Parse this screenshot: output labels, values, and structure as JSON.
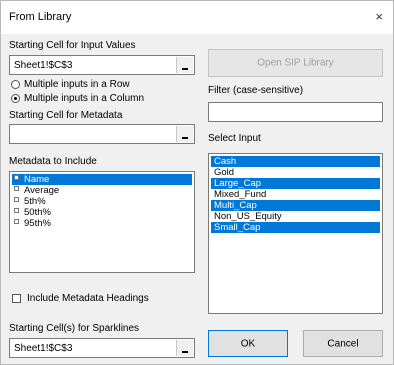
{
  "window": {
    "title": "From Library",
    "close_glyph": "×"
  },
  "input_values": {
    "label": "Starting Cell for Input Values",
    "value": "Sheet1!$C$3"
  },
  "open_sip_button": {
    "label": "Open SIP Library",
    "enabled": false
  },
  "layout_options": [
    {
      "label": "Multiple inputs in a Row",
      "checked": false
    },
    {
      "label": "Multiple inputs in a Column",
      "checked": true
    }
  ],
  "filter": {
    "label": "Filter (case-sensitive)",
    "value": ""
  },
  "metadata": {
    "label": "Starting Cell for Metadata",
    "value": ""
  },
  "select_input": {
    "label": "Select Input",
    "items": [
      {
        "text": "Cash",
        "selected": true
      },
      {
        "text": "Gold",
        "selected": false
      },
      {
        "text": "Large_Cap",
        "selected": true
      },
      {
        "text": "Mixed_Fund",
        "selected": false
      },
      {
        "text": "Multi_Cap",
        "selected": true
      },
      {
        "text": "Non_US_Equity",
        "selected": false
      },
      {
        "text": "Small_Cap",
        "selected": true
      }
    ]
  },
  "metadata_include": {
    "label": "Metadata to Include",
    "items": [
      {
        "text": "Name",
        "selected": true
      },
      {
        "text": "Average",
        "selected": false
      },
      {
        "text": "5th%",
        "selected": false
      },
      {
        "text": "50th%",
        "selected": false
      },
      {
        "text": "95th%",
        "selected": false
      }
    ]
  },
  "include_headings": {
    "label": "Include Metadata Headings",
    "checked": false
  },
  "sparklines": {
    "label": "Starting Cell(s) for Sparklines",
    "value": "Sheet1!$C$3"
  },
  "buttons": {
    "ok": "OK",
    "cancel": "Cancel"
  },
  "colors": {
    "selection": "#0078d7",
    "dialog_bg": "#f0f0f0"
  }
}
